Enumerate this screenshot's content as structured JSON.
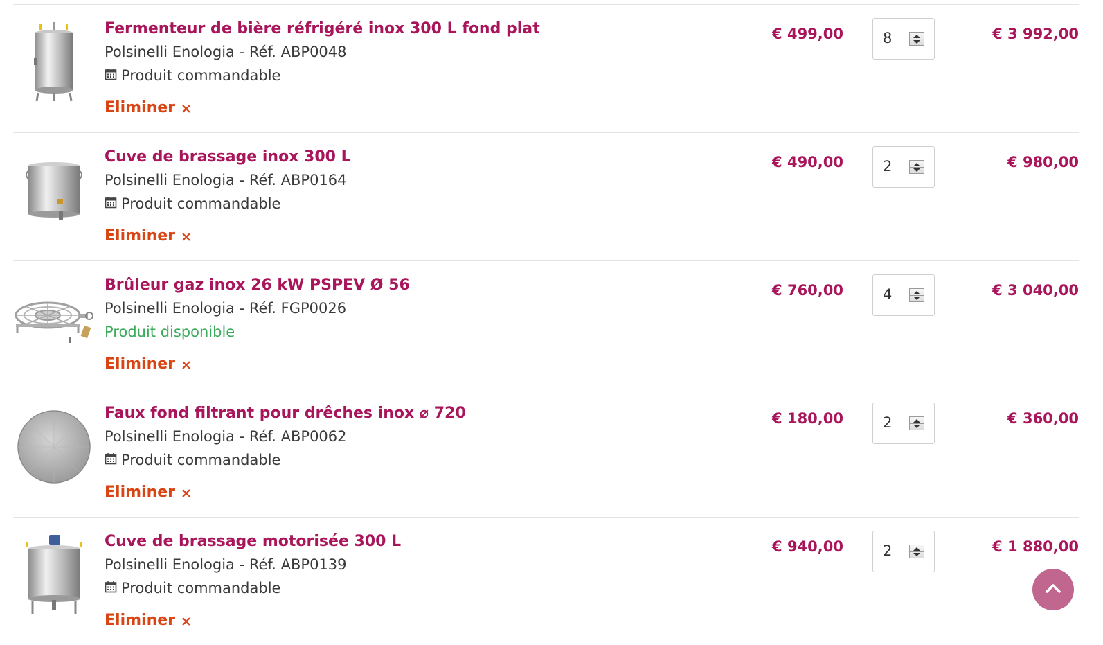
{
  "colors": {
    "accent": "#a8155a",
    "remove": "#d94413",
    "in_stock": "#3dab5c",
    "text": "#3a3a3a",
    "scroll_button": "#c0668f"
  },
  "cart": {
    "items": [
      {
        "title": "Fermenteur de bière réfrigéré inox 300 L fond plat",
        "meta": "Polsinelli Enologia - Réf. ABP0048",
        "availability": "Produit commandable",
        "availability_icon": "calendar-icon",
        "remove_label": "Eliminer",
        "unit_price": "€ 499,00",
        "quantity": "8",
        "total": "€ 3 992,00"
      },
      {
        "title": "Cuve de brassage inox 300 L",
        "meta": "Polsinelli Enologia - Réf. ABP0164",
        "availability": "Produit commandable",
        "availability_icon": "calendar-icon",
        "remove_label": "Eliminer",
        "unit_price": "€ 490,00",
        "quantity": "2",
        "total": "€ 980,00"
      },
      {
        "title": "Brûleur gaz inox 26 kW PSPEV Ø 56",
        "meta": "Polsinelli Enologia - Réf. FGP0026",
        "availability": "Produit disponible",
        "availability_icon": "",
        "remove_label": "Eliminer",
        "unit_price": "€ 760,00",
        "quantity": "4",
        "total": "€ 3 040,00"
      },
      {
        "title": "Faux fond filtrant pour drêches inox ⌀ 720",
        "meta": "Polsinelli Enologia - Réf. ABP0062",
        "availability": "Produit commandable",
        "availability_icon": "calendar-icon",
        "remove_label": "Eliminer",
        "unit_price": "€ 180,00",
        "quantity": "2",
        "total": "€ 360,00"
      },
      {
        "title": "Cuve de brassage motorisée 300 L",
        "meta": "Polsinelli Enologia - Réf. ABP0139",
        "availability": "Produit commandable",
        "availability_icon": "calendar-icon",
        "remove_label": "Eliminer",
        "unit_price": "€ 940,00",
        "quantity": "2",
        "total": "€ 1 880,00"
      }
    ]
  },
  "scroll_top": {
    "icon": "chevron-up-icon"
  }
}
